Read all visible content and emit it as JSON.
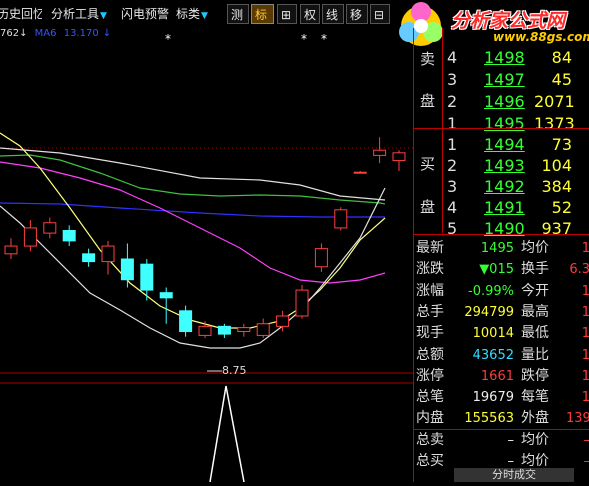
{
  "toolbar": {
    "items": [
      {
        "label": "历史回忆",
        "has_arrow": false
      },
      {
        "label": "分析工具",
        "has_arrow": true
      },
      {
        "label": "闪电预警",
        "has_arrow": false
      },
      {
        "label": "标类",
        "has_arrow": true
      },
      {
        "label": "测",
        "has_arrow": false
      },
      {
        "label": "标",
        "has_arrow": false
      },
      {
        "label": "⊞",
        "has_arrow": false
      },
      {
        "label": "权",
        "has_arrow": false
      },
      {
        "label": "线",
        "has_arrow": false
      },
      {
        "label": "移",
        "has_arrow": false
      },
      {
        "label": "⊟",
        "has_arrow": false
      }
    ]
  },
  "logo": {
    "title": "分析家公式网",
    "url": "www.88gs.com"
  },
  "legend": {
    "ma_prev": "762",
    "ma_label": "MA6",
    "ma_value": "13.170"
  },
  "chart": {
    "low_marker": "8.75",
    "colors": {
      "up": "#ff4040",
      "down": "#40ffff",
      "ma_white": "#e0e0e0",
      "ma_yellow": "#ffff80",
      "ma_magenta": "#ff40ff",
      "ma_green": "#40c040",
      "ma_blue": "#3030ff",
      "grid": "#aa0000"
    }
  },
  "chart_data": {
    "type": "candlestick",
    "low_label": "8.75",
    "candles": [
      {
        "o": 12.0,
        "c": 12.3,
        "h": 12.6,
        "l": 11.8
      },
      {
        "o": 12.3,
        "c": 13.0,
        "h": 13.3,
        "l": 12.1
      },
      {
        "o": 12.8,
        "c": 13.2,
        "h": 13.4,
        "l": 12.6
      },
      {
        "o": 12.9,
        "c": 12.5,
        "h": 13.1,
        "l": 12.3
      },
      {
        "o": 12.0,
        "c": 11.7,
        "h": 12.2,
        "l": 11.5
      },
      {
        "o": 11.7,
        "c": 12.3,
        "h": 12.5,
        "l": 11.2
      },
      {
        "o": 11.8,
        "c": 11.0,
        "h": 12.4,
        "l": 10.7
      },
      {
        "o": 11.6,
        "c": 10.6,
        "h": 11.8,
        "l": 10.2
      },
      {
        "o": 10.5,
        "c": 10.3,
        "h": 10.7,
        "l": 9.3
      },
      {
        "o": 9.8,
        "c": 9.0,
        "h": 10.0,
        "l": 8.8
      },
      {
        "o": 8.85,
        "c": 9.2,
        "h": 9.4,
        "l": 8.75
      },
      {
        "o": 9.2,
        "c": 8.9,
        "h": 9.3,
        "l": 8.75
      },
      {
        "o": 9.0,
        "c": 9.15,
        "h": 9.3,
        "l": 8.8
      },
      {
        "o": 8.85,
        "c": 9.3,
        "h": 9.5,
        "l": 8.75
      },
      {
        "o": 9.2,
        "c": 9.6,
        "h": 9.8,
        "l": 9.0
      },
      {
        "o": 9.6,
        "c": 10.6,
        "h": 10.8,
        "l": 9.5
      },
      {
        "o": 11.5,
        "c": 12.2,
        "h": 12.4,
        "l": 11.3
      },
      {
        "o": 13.0,
        "c": 13.7,
        "h": 13.8,
        "l": 12.9
      },
      {
        "o": 15.15,
        "c": 15.15,
        "h": 15.2,
        "l": 15.1
      },
      {
        "o": 15.8,
        "c": 16.0,
        "h": 16.5,
        "l": 15.5
      },
      {
        "o": 15.6,
        "c": 15.9,
        "h": 16.0,
        "l": 15.2
      }
    ]
  },
  "quote": {
    "sell": [
      {
        "label": "4",
        "price": "1498",
        "vol": "84"
      },
      {
        "label": "3",
        "price": "1497",
        "vol": "45"
      },
      {
        "label": "2",
        "price": "1496",
        "vol": "2071"
      },
      {
        "label": "1",
        "price": "1495",
        "vol": "1373"
      }
    ],
    "sell_section_label": [
      "卖",
      "盘"
    ],
    "buy": [
      {
        "label": "1",
        "price": "1494",
        "vol": "73"
      },
      {
        "label": "2",
        "price": "1493",
        "vol": "104"
      },
      {
        "label": "3",
        "price": "1492",
        "vol": "384"
      },
      {
        "label": "4",
        "price": "1491",
        "vol": "52"
      },
      {
        "label": "5",
        "price": "1490",
        "vol": "937"
      }
    ],
    "buy_section_label": [
      "买",
      "盘"
    ],
    "stats": [
      {
        "l1": "最新",
        "v1": "1495",
        "c1": "grn",
        "l2": "均价",
        "v2": "1"
      },
      {
        "l1": "涨跌",
        "v1": "▼015",
        "c1": "grn",
        "l2": "换手",
        "v2": "6.3"
      },
      {
        "l1": "涨幅",
        "v1": "-0.99%",
        "c1": "grn",
        "l2": "今开",
        "v2": "1"
      },
      {
        "l1": "总手",
        "v1": "294799",
        "c1": "yel",
        "l2": "最高",
        "v2": "1"
      },
      {
        "l1": "现手",
        "v1": "10014",
        "c1": "yel",
        "l2": "最低",
        "v2": "1"
      },
      {
        "l1": "总额",
        "v1": "43652",
        "c1": "cyan",
        "l2": "量比",
        "v2": "1"
      },
      {
        "l1": "涨停",
        "v1": "1661",
        "c1": "red",
        "l2": "跌停",
        "v2": "1"
      },
      {
        "l1": "总笔",
        "v1": "19679",
        "c1": "wht",
        "l2": "每笔",
        "v2": "1"
      },
      {
        "l1": "内盘",
        "v1": "155563",
        "c1": "yel",
        "l2": "外盘",
        "v2": "139"
      },
      {
        "l1": "总卖",
        "v1": "–",
        "c1": "wht",
        "l2": "均价",
        "v2": "–"
      },
      {
        "l1": "总买",
        "v1": "–",
        "c1": "wht",
        "l2": "均价",
        "v2": "–"
      }
    ],
    "bottom_tab": "分时成交"
  }
}
